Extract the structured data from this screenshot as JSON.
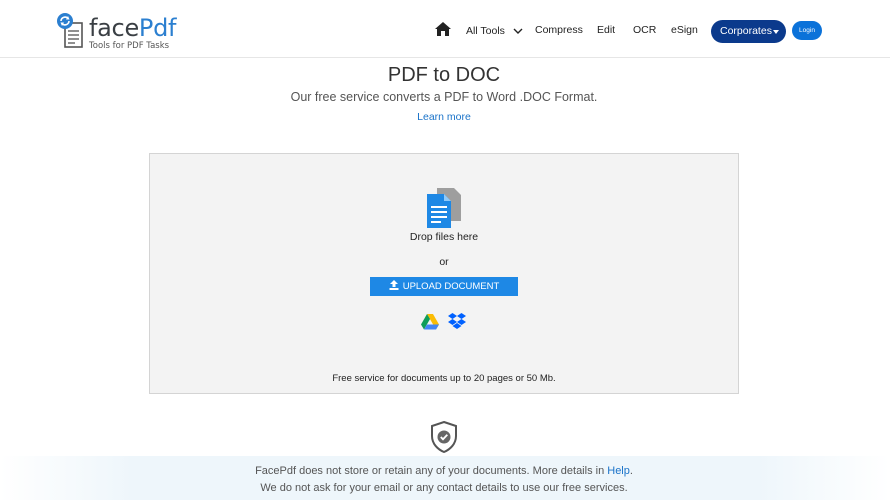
{
  "brand": {
    "name_part1": "face",
    "name_part2": "Pdf",
    "tagline": "Tools for PDF Tasks"
  },
  "nav": {
    "all_tools": "All Tools",
    "compress": "Compress",
    "edit": "Edit",
    "ocr": "OCR",
    "esign": "eSign",
    "corporates": "Corporates",
    "login": "Login"
  },
  "main": {
    "title": "PDF to DOC",
    "subtitle": "Our free service converts a PDF to Word .DOC Format.",
    "learn_more": "Learn more"
  },
  "dropzone": {
    "drop_text": "Drop files here",
    "or_text": "or",
    "upload_label": "UPLOAD DOCUMENT",
    "limit_text": "Free service for documents up to 20 pages or 50 Mb."
  },
  "privacy": {
    "line1_text": "FacePdf does not store or retain any of your documents. More details in ",
    "line1_link": "Help",
    "line1_end": ".",
    "line2_text": "We do not ask for your email or any contact details to use our free services."
  },
  "icons": {
    "logo": "facepdf-logo-icon",
    "home": "home-icon",
    "chevron": "chevron-down-icon",
    "document": "document-icon",
    "upload": "upload-icon",
    "google_drive": "google-drive-icon",
    "dropbox": "dropbox-icon",
    "shield": "shield-check-icon"
  },
  "colors": {
    "brand_blue": "#2b7fd0",
    "corporates_button": "#0b3a8c",
    "login_button": "#0b72d9",
    "upload_button": "#1e88e5",
    "link": "#1a73c9"
  }
}
